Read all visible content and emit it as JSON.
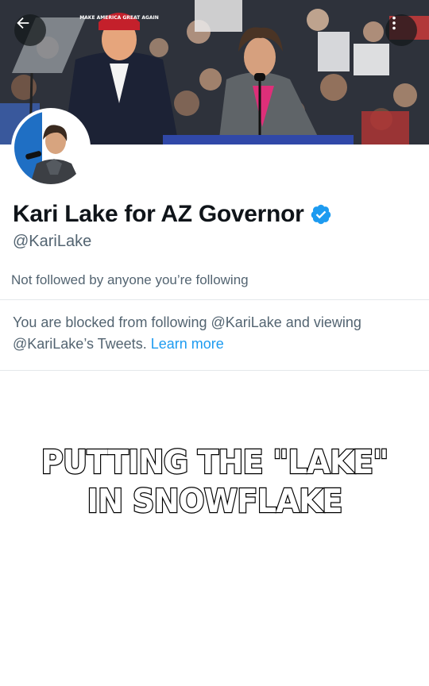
{
  "header": {
    "back_icon": "arrow-left-icon",
    "more_icon": "more-vertical-icon"
  },
  "banner": {
    "description_icon": "banner-photo",
    "hat_text": "MAKE AMERICA GREAT AGAIN"
  },
  "profile": {
    "display_name": "Kari Lake for AZ Governor",
    "verified_icon": "verified-badge-icon",
    "handle": "@KariLake",
    "followers_note": "Not followed by anyone you’re following"
  },
  "blocked": {
    "message": "You are blocked from following @KariLake and viewing @KariLake’s Tweets.",
    "learn_more": "Learn more"
  },
  "caption": {
    "line1": "PUTTING THE \"LAKE\"",
    "line2": "IN SNOWFLAKE"
  },
  "colors": {
    "accent": "#1d9bf0",
    "secondary_text": "#536471",
    "primary_text": "#0f1419",
    "divider": "#e4e8eb"
  }
}
